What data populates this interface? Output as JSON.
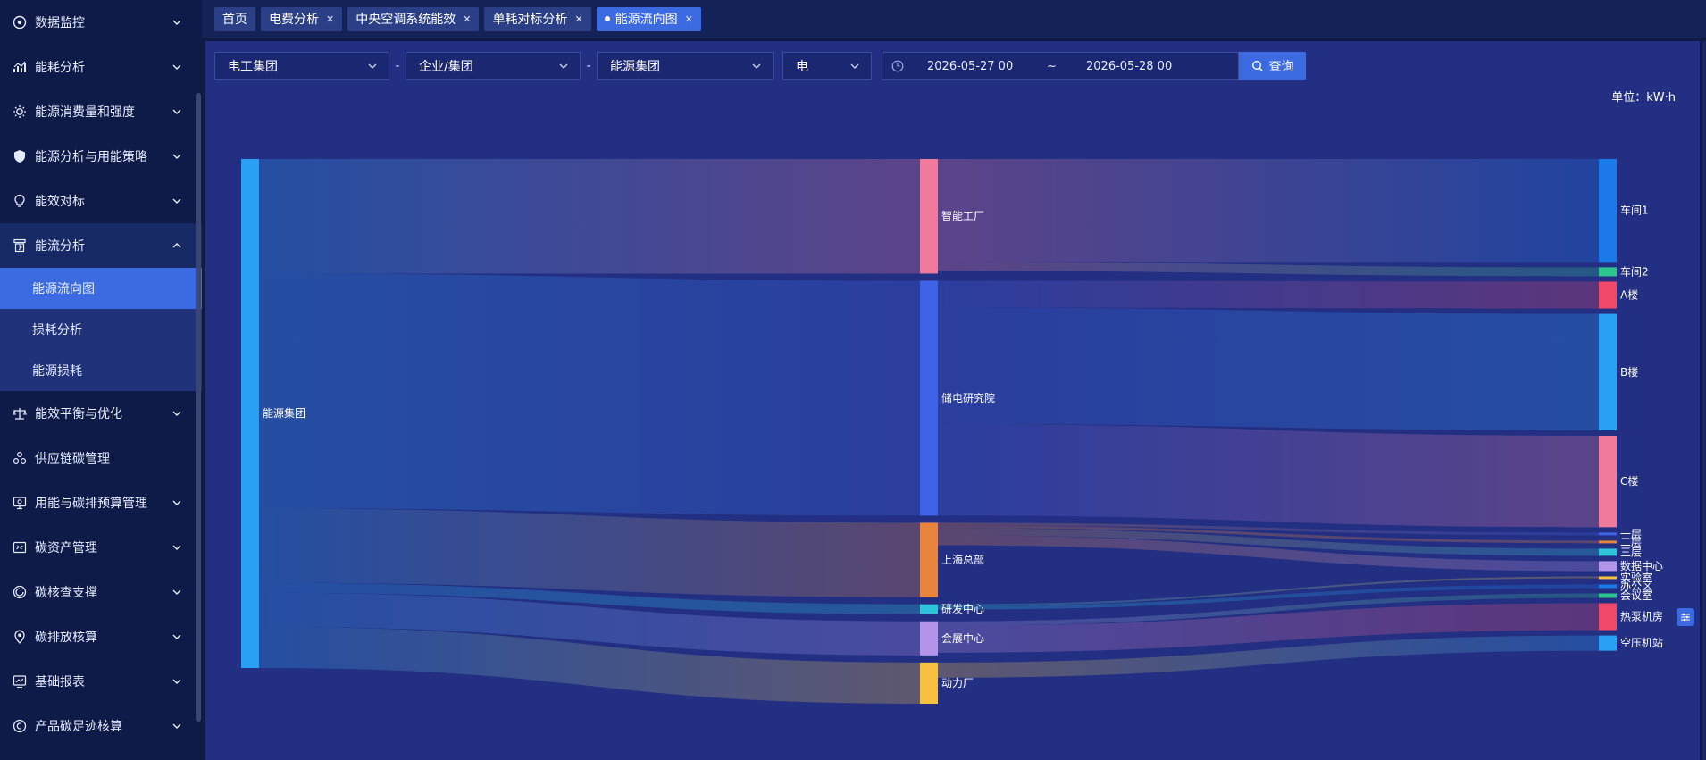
{
  "sidebar": {
    "items": [
      {
        "label": "数据监控",
        "icon": "monitor-icon"
      },
      {
        "label": "能耗分析",
        "icon": "chart-icon"
      },
      {
        "label": "能源消费量和强度",
        "icon": "sun-icon"
      },
      {
        "label": "能源分析与用能策略",
        "icon": "shield-icon"
      },
      {
        "label": "能效对标",
        "icon": "bulb-icon"
      },
      {
        "label": "能流分析",
        "icon": "flow-icon"
      },
      {
        "label": "能效平衡与优化",
        "icon": "balance-icon"
      },
      {
        "label": "供应链碳管理",
        "icon": "supply-icon"
      },
      {
        "label": "用能与碳排预算管理",
        "icon": "budget-icon"
      },
      {
        "label": "碳资产管理",
        "icon": "asset-icon"
      },
      {
        "label": "碳核查支撑",
        "icon": "verify-icon"
      },
      {
        "label": "碳排放核算",
        "icon": "location-icon"
      },
      {
        "label": "基础报表",
        "icon": "report-icon"
      },
      {
        "label": "产品碳足迹核算",
        "icon": "footprint-icon"
      }
    ],
    "submenu": [
      "能源流向图",
      "损耗分析",
      "能源损耗"
    ]
  },
  "tabs": [
    {
      "label": "首页",
      "closable": false
    },
    {
      "label": "电费分析",
      "closable": true
    },
    {
      "label": "中央空调系统能效",
      "closable": true
    },
    {
      "label": "单耗对标分析",
      "closable": true
    },
    {
      "label": "能源流向图",
      "closable": true,
      "active": true
    }
  ],
  "filters": {
    "group": "电工集团",
    "level": "企业/集团",
    "org": "能源集团",
    "energy": "电",
    "date_start": "2026-05-27 00",
    "date_sep": "~",
    "date_end": "2026-05-28 00",
    "query_label": "查询"
  },
  "unit_label": "单位：kW·h",
  "colors": {
    "accent": "#3c6ae0",
    "sidebar_bg": "#0e1a47",
    "panel_bg": "#232f82"
  },
  "chart_data": {
    "type": "sankey",
    "nodes": [
      {
        "name": "能源集团",
        "label": "能源集团",
        "color": "#2aa0f5",
        "layer": 0
      },
      {
        "name": "智能工厂",
        "label": "智能工厂",
        "color": "#f07a9b",
        "layer": 1
      },
      {
        "name": "储电研究院",
        "label": "储电研究院",
        "color": "#3f63e6",
        "layer": 1
      },
      {
        "name": "上海总部",
        "label": "上海总部",
        "color": "#e9843f",
        "layer": 1
      },
      {
        "name": "研发中心",
        "label": "研发中心",
        "color": "#2fc4d9",
        "layer": 1
      },
      {
        "name": "会展中心",
        "label": "会展中心",
        "color": "#b394e8",
        "layer": 1
      },
      {
        "name": "动力厂",
        "label": "动力厂",
        "color": "#f8c03f",
        "layer": 1
      },
      {
        "name": "车间1",
        "label": "车间1",
        "color": "#1a7ae8",
        "layer": 2
      },
      {
        "name": "车间2",
        "label": "车间2",
        "color": "#2ec48f",
        "layer": 2
      },
      {
        "name": "A楼",
        "label": "A楼",
        "color": "#f04868",
        "layer": 2
      },
      {
        "name": "B楼",
        "label": "B楼",
        "color": "#2aa0f5",
        "layer": 2
      },
      {
        "name": "C楼",
        "label": "C楼",
        "color": "#f07a9b",
        "layer": 2
      },
      {
        "name": "一层",
        "label": "一层",
        "color": "#3f63e6",
        "layer": 2
      },
      {
        "name": "二层",
        "label": "二层",
        "color": "#e9843f",
        "layer": 2
      },
      {
        "name": "三层",
        "label": "三层",
        "color": "#2fc4d9",
        "layer": 2
      },
      {
        "name": "数据中心",
        "label": "数据中心",
        "color": "#b394e8",
        "layer": 2
      },
      {
        "name": "实验室",
        "label": "实验室",
        "color": "#f8c03f",
        "layer": 2
      },
      {
        "name": "办公区",
        "label": "办公区",
        "color": "#1a7ae8",
        "layer": 2
      },
      {
        "name": "会议室",
        "label": "会议室",
        "color": "#2ec48f",
        "layer": 2
      },
      {
        "name": "热泵机房",
        "label": "热泵机房",
        "color": "#f04868",
        "layer": 2
      },
      {
        "name": "空压机站",
        "label": "空压机站",
        "color": "#2aa0f5",
        "layer": 2
      }
    ],
    "links": [
      {
        "source": "能源集团",
        "target": "智能工厂",
        "value": 1280
      },
      {
        "source": "能源集团",
        "target": "储电研究院",
        "value": 2620
      },
      {
        "source": "能源集团",
        "target": "上海总部",
        "value": 830
      },
      {
        "source": "能源集团",
        "target": "研发中心",
        "value": 110
      },
      {
        "source": "能源集团",
        "target": "会展中心",
        "value": 380
      },
      {
        "source": "能源集团",
        "target": "动力厂",
        "value": 460
      },
      {
        "source": "智能工厂",
        "target": "车间1",
        "value": 1150
      },
      {
        "source": "智能工厂",
        "target": "车间2",
        "value": 100
      },
      {
        "source": "储电研究院",
        "target": "A楼",
        "value": 300
      },
      {
        "source": "储电研究院",
        "target": "B楼",
        "value": 1300
      },
      {
        "source": "储电研究院",
        "target": "C楼",
        "value": 1020
      },
      {
        "source": "上海总部",
        "target": "一层",
        "value": 30
      },
      {
        "source": "上海总部",
        "target": "二层",
        "value": 30
      },
      {
        "source": "上海总部",
        "target": "三层",
        "value": 80
      },
      {
        "source": "上海总部",
        "target": "数据中心",
        "value": 110
      },
      {
        "source": "研发中心",
        "target": "实验室",
        "value": 20
      },
      {
        "source": "研发中心",
        "target": "办公区",
        "value": 40
      },
      {
        "source": "会展中心",
        "target": "会议室",
        "value": 50
      },
      {
        "source": "会展中心",
        "target": "热泵机房",
        "value": 300
      },
      {
        "source": "动力厂",
        "target": "空压机站",
        "value": 170
      }
    ]
  }
}
